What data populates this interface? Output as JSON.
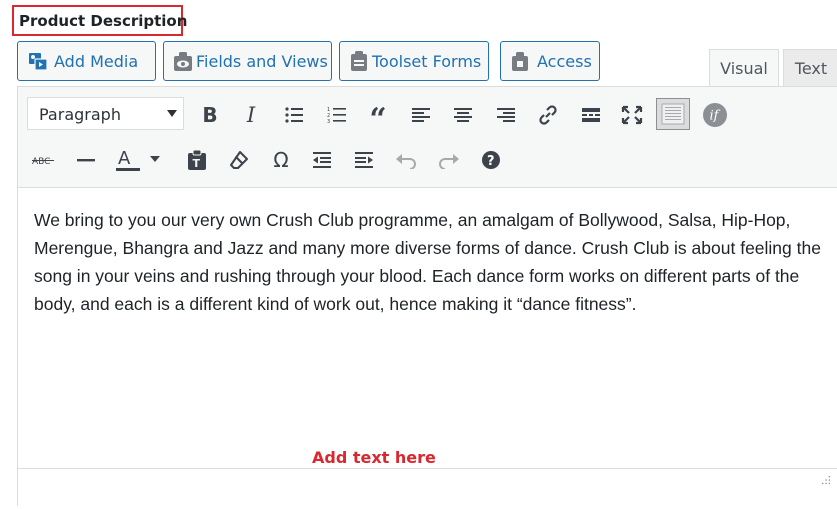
{
  "field": {
    "title": "Product Description"
  },
  "media_buttons": [
    {
      "label": "Add Media",
      "icon": "add-media-icon"
    },
    {
      "label": "Fields and Views",
      "icon": "fields-views-icon"
    },
    {
      "label": "Toolset Forms",
      "icon": "toolset-forms-icon"
    },
    {
      "label": "Access",
      "icon": "access-lock-icon"
    }
  ],
  "tabs": [
    {
      "label": "Visual",
      "active": true
    },
    {
      "label": "Text",
      "active": false
    }
  ],
  "toolbar": {
    "format_select": {
      "value": "Paragraph"
    },
    "row1_icons": [
      "bold-icon",
      "italic-icon",
      "bulleted-list-icon",
      "numbered-list-icon",
      "blockquote-icon",
      "align-left-icon",
      "align-center-icon",
      "align-right-icon",
      "insert-link-icon",
      "read-more-icon",
      "fullscreen-icon",
      "toolbar-toggle-icon",
      "conditional-if-icon"
    ],
    "row2_icons": [
      "strikethrough-icon",
      "horizontal-line-icon",
      "text-color-icon",
      "paste-as-text-icon",
      "clear-formatting-icon",
      "special-character-icon",
      "outdent-icon",
      "indent-icon",
      "undo-icon",
      "redo-icon",
      "help-icon"
    ]
  },
  "content": {
    "paragraph": "We bring to you our very own Crush Club programme, an amalgam of Bollywood, Salsa, Hip-Hop, Merengue, Bhangra and Jazz and many more diverse forms of dance. Crush Club is about feeling the song in your veins and rushing through your blood. Each dance form works on different parts of the body, and each is a different kind of work out, hence making it “dance fitness”."
  },
  "annotation": {
    "text": "Add text here",
    "color": "#d9282f"
  },
  "colors": {
    "accent": "#2271b1",
    "highlight": "#d9282f",
    "toolbar_bg": "#f6f7f7",
    "border": "#dcdcde"
  }
}
